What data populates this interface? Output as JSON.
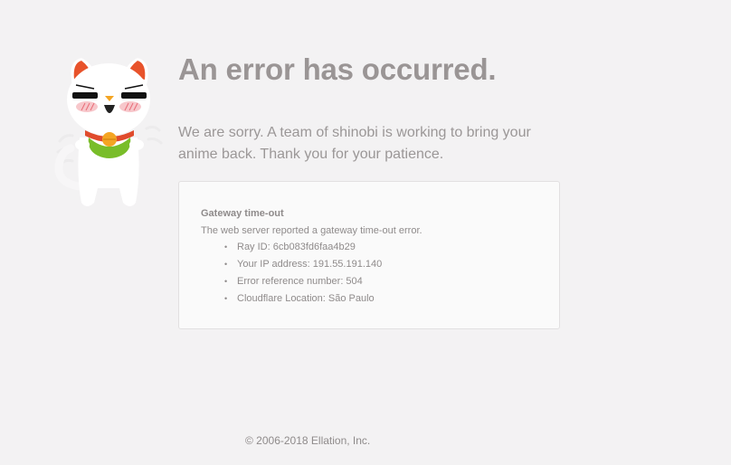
{
  "page": {
    "title": "An error has occurred.",
    "subtitle": "We are sorry. A team of shinobi is working to bring your anime back. Thank you for your patience."
  },
  "error": {
    "heading": "Gateway time-out",
    "description": "The web server reported a gateway time-out error.",
    "details": [
      "Ray ID: 6cb083fd6faa4b29",
      "Your IP address: 191.55.191.140",
      "Error reference number: 504",
      "Cloudflare Location: São Paulo"
    ]
  },
  "footer": {
    "copyright": "© 2006-2018 Ellation, Inc."
  },
  "icons": {
    "mascot": "cat-mascot-icon",
    "bullet": "bullet-dot"
  },
  "colors": {
    "background": "#f3f2f3",
    "text": "#9a9595",
    "box_background": "#fafafa",
    "box_border": "#e2e0e1",
    "mascot_ears": "#e8532b",
    "mascot_collar": "#e04b2c",
    "mascot_bib": "#79bd29",
    "mascot_bell": "#f4a523"
  }
}
